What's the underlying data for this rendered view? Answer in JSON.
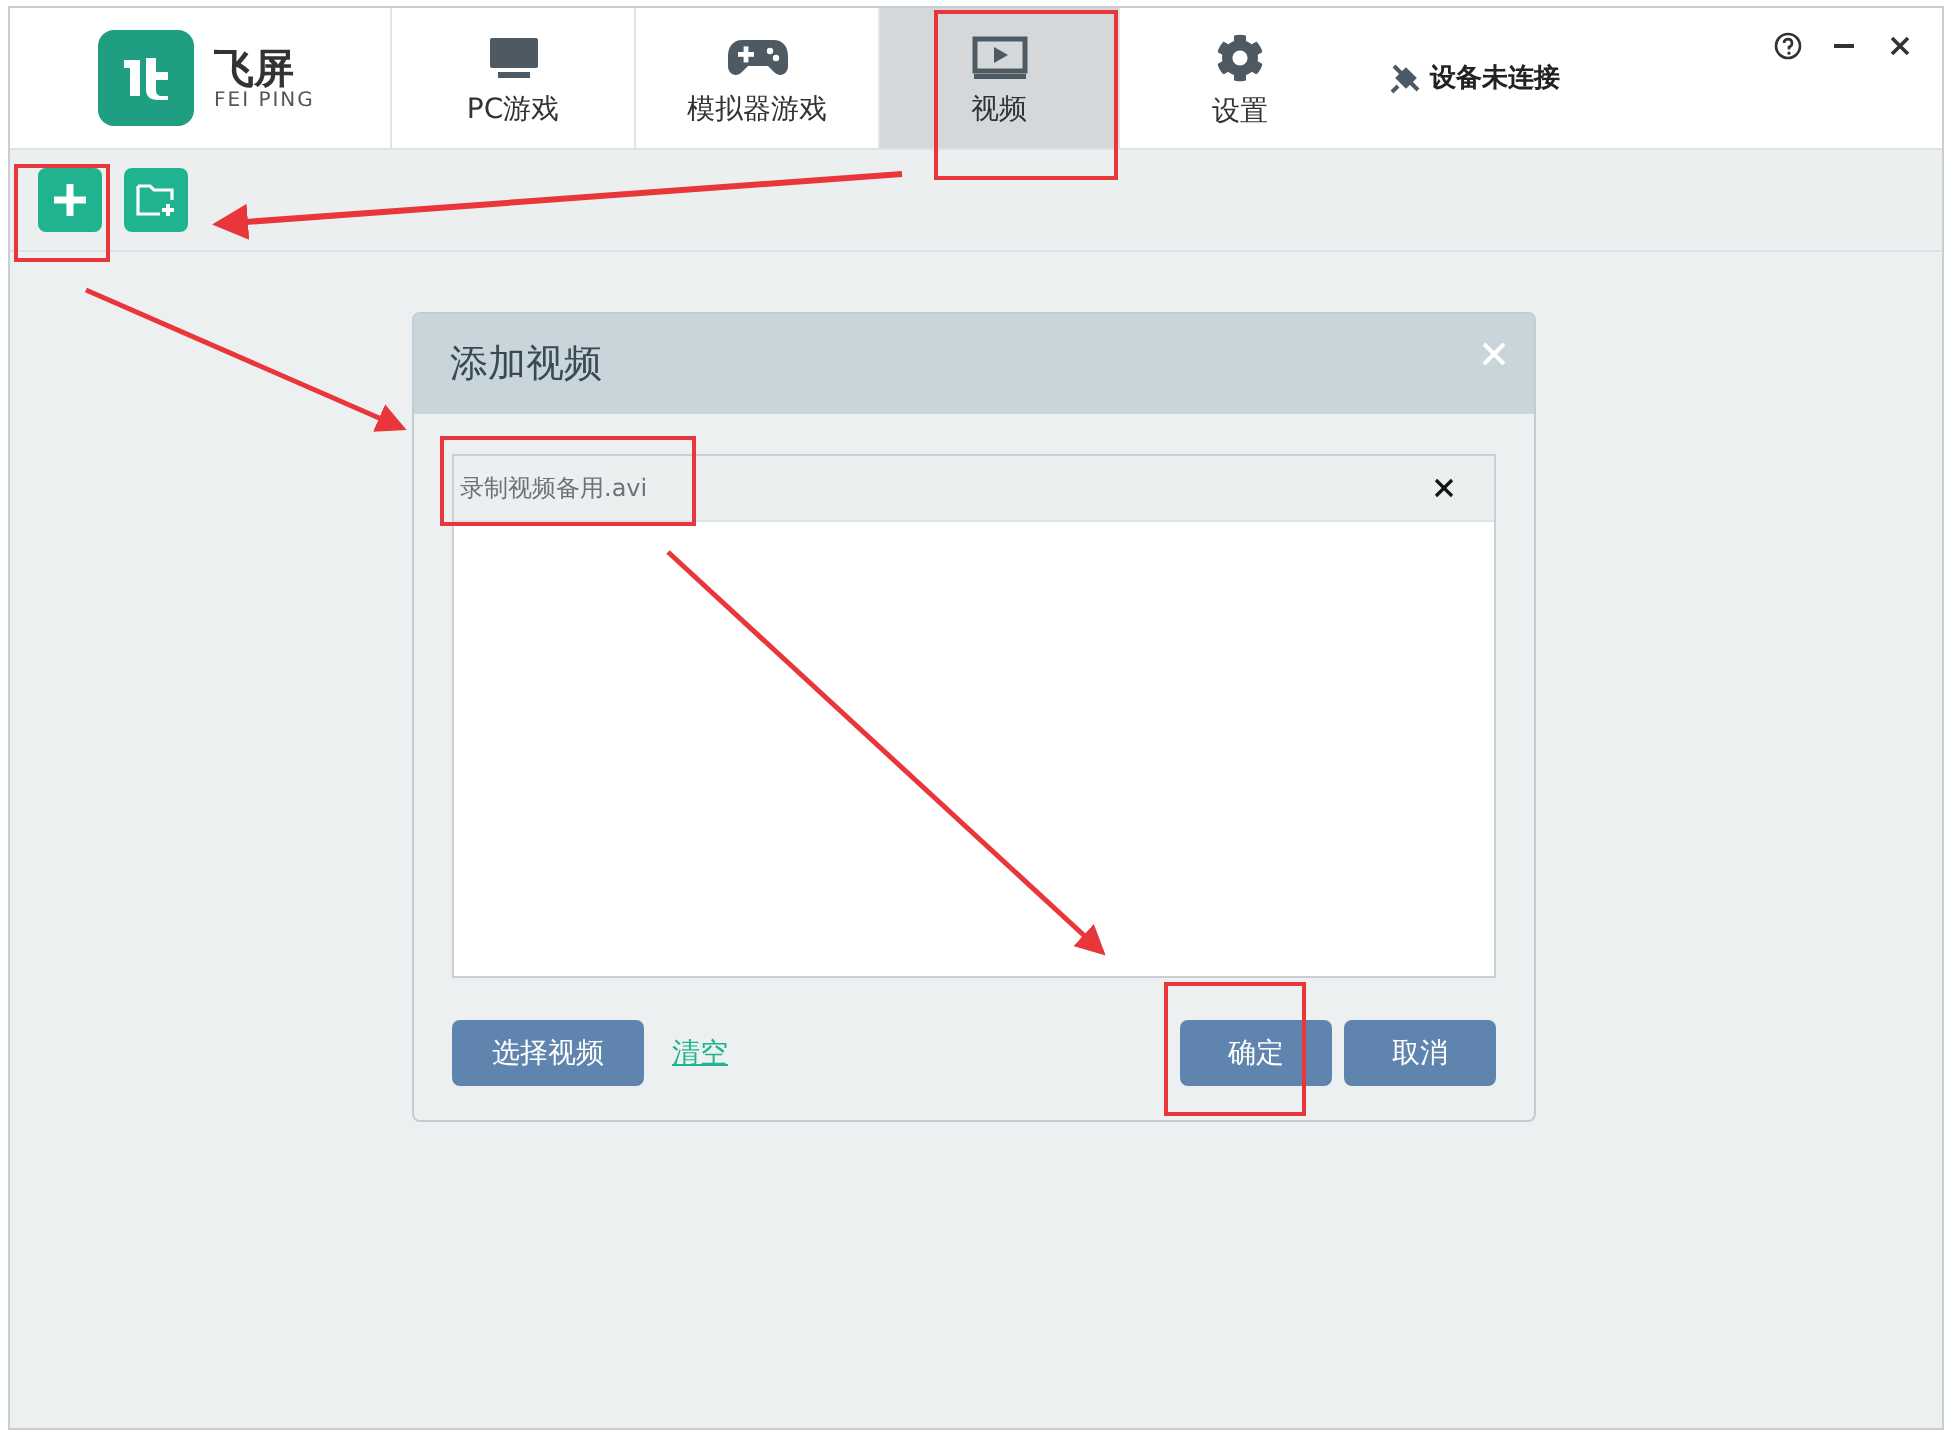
{
  "app": {
    "logo_glyph": "飞屏",
    "logo_sub": "FEI PING"
  },
  "tabs": [
    {
      "kind": "monitor",
      "label": "PC游戏",
      "selected": false
    },
    {
      "kind": "gamepad",
      "label": "模拟器游戏",
      "selected": false
    },
    {
      "kind": "video",
      "label": "视频",
      "selected": true
    },
    {
      "kind": "gear",
      "label": "设置",
      "selected": false
    }
  ],
  "status": "设备未连接",
  "dialog": {
    "title": "添加视频",
    "files": [
      {
        "name": "录制视频备用.avi"
      }
    ],
    "select_button": "选择视频",
    "clear_link": "清空",
    "confirm_button": "确定",
    "cancel_button": "取消"
  }
}
